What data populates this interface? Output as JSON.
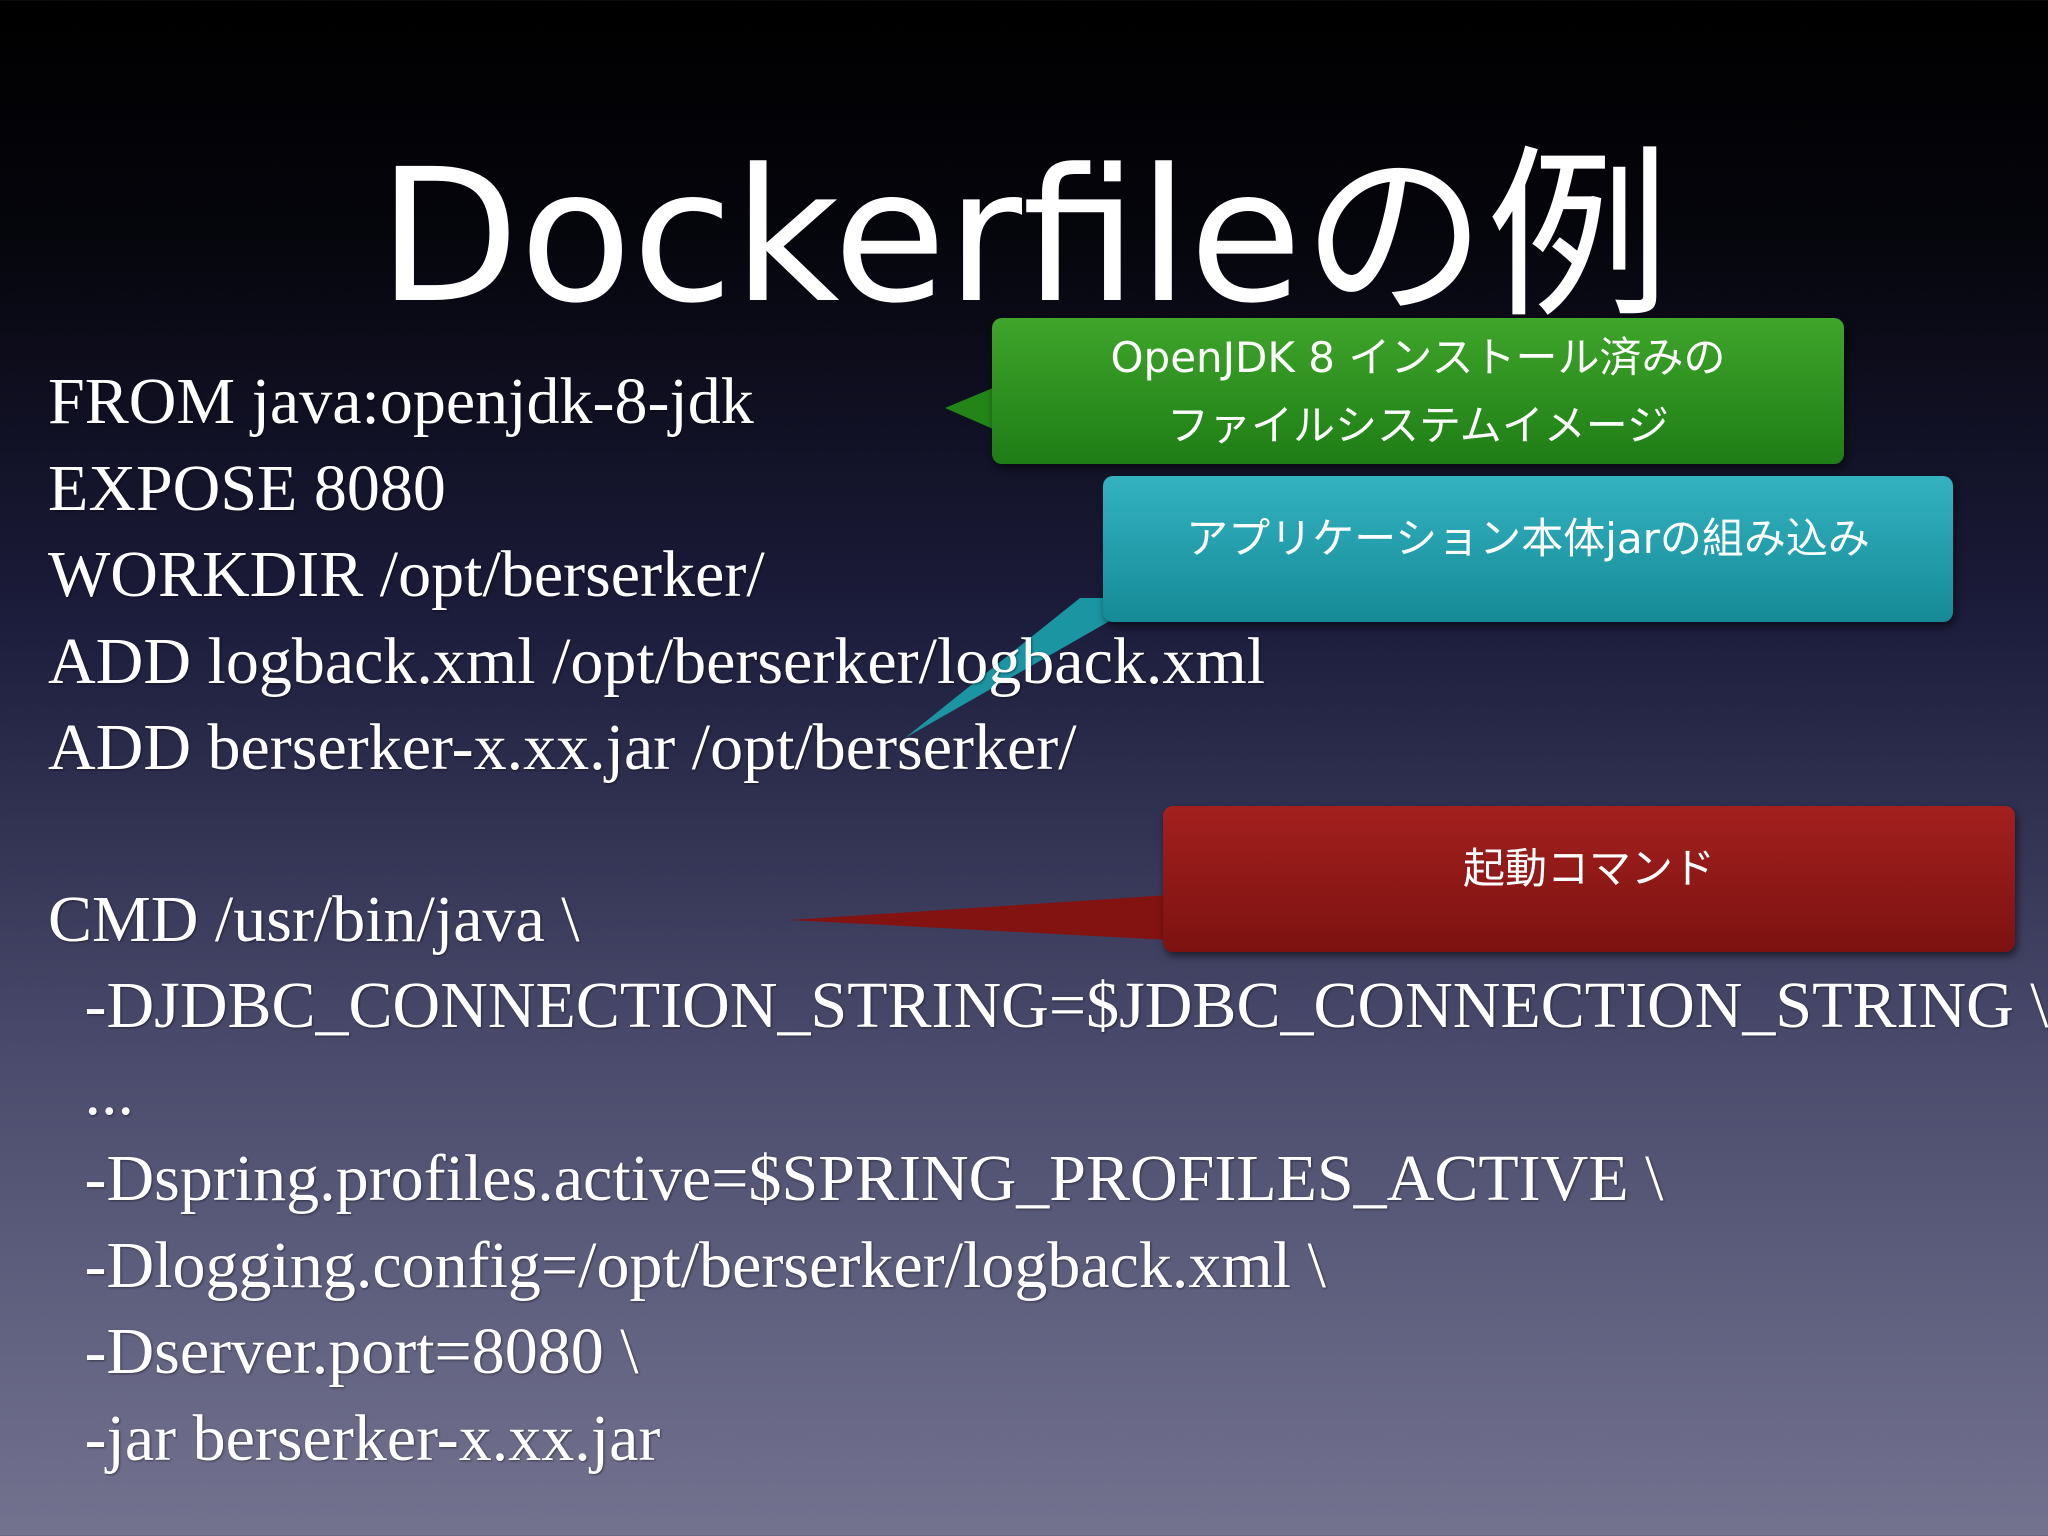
{
  "slide": {
    "title": "Dockerfileの例",
    "code": [
      "FROM java:openjdk-8-jdk",
      "EXPOSE 8080",
      "WORKDIR /opt/berserker/",
      "ADD logback.xml /opt/berserker/logback.xml",
      "ADD berserker-x.xx.jar /opt/berserker/",
      "CMD /usr/bin/java \\",
      " -DJDBC_CONNECTION_STRING=$JDBC_CONNECTION_STRING \\",
      " ...",
      " -Dspring.profiles.active=$SPRING_PROFILES_ACTIVE \\",
      " -Dlogging.config=/opt/berserker/logback.xml \\",
      " -Dserver.port=8080 \\",
      " -jar berserker-x.xx.jar"
    ],
    "callouts": {
      "base_image": {
        "line1": "OpenJDK 8 インストール済みの",
        "line2": "ファイルシステムイメージ",
        "color": "#2a8f20"
      },
      "app_jar": {
        "text": "アプリケーション本体jarの組み込み",
        "color": "#1fa0ad"
      },
      "start_command": {
        "text": "起動コマンド",
        "color": "#921816"
      }
    }
  }
}
